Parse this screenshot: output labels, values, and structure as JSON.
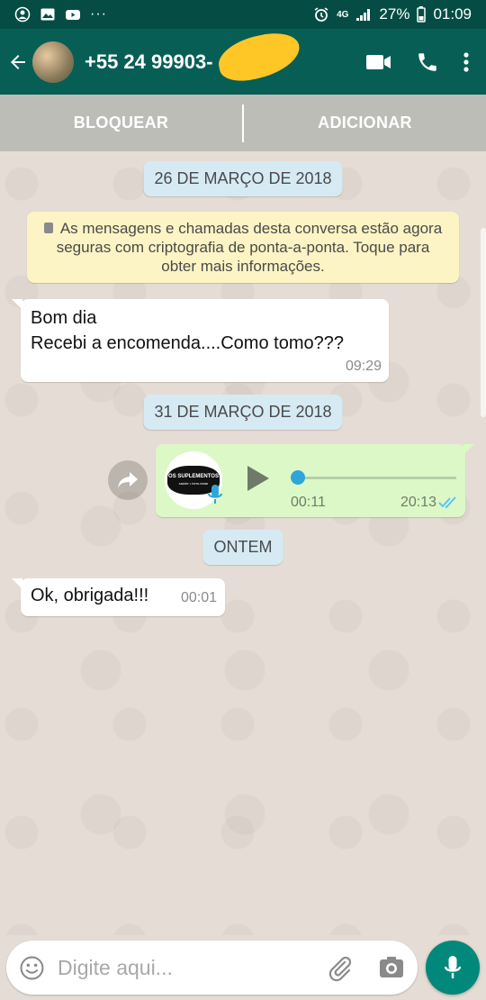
{
  "status_bar": {
    "network": "4G",
    "battery": "27%",
    "time": "01:09",
    "more": "···"
  },
  "header": {
    "contact_name": "+55 24 99903-",
    "icons": [
      "back-arrow-icon",
      "video-call-icon",
      "phone-icon",
      "more-vert-icon"
    ]
  },
  "action_bar": {
    "block_label": "BLOQUEAR",
    "add_label": "ADICIONAR"
  },
  "chat": {
    "date_1": "26 DE MARÇO DE 2018",
    "encryption_notice": "As mensagens e chamadas desta conversa estão agora seguras com criptografia de ponta-a-ponta. Toque para obter mais informações.",
    "message_1": {
      "line_1": "Bom dia",
      "line_2": "Recebi a encomenda....Como tomo???",
      "time": "09:29"
    },
    "date_2": "31 DE MARÇO DE 2018",
    "voice_message": {
      "thumb_text_1": "OS SUPLEMENTOS",
      "thumb_text_2": "saúde • bem-estar",
      "duration": "00:11",
      "time": "20:13",
      "progress": 0.0,
      "status_color": "#4fc3f7"
    },
    "date_3": "ONTEM",
    "message_2": {
      "text": "Ok, obrigada!!!",
      "time": "00:01"
    }
  },
  "composer": {
    "placeholder": "Digite aqui..."
  },
  "colors": {
    "header": "#075e54",
    "status_bar": "#054d44",
    "outgoing_bubble": "#dcf8c6",
    "mic_button": "#00897b"
  }
}
